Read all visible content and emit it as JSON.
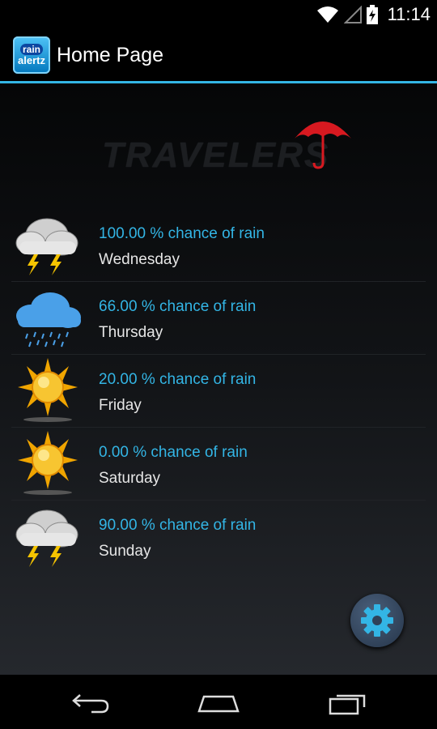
{
  "status_bar": {
    "time": "11:14",
    "icons": [
      "wifi-icon",
      "no-signal-icon",
      "battery-charging-icon"
    ]
  },
  "action_bar": {
    "logo_line1": "rain",
    "logo_line2": "alertz",
    "title": "Home Page"
  },
  "sponsor": {
    "text": "TRAVELERS",
    "colors": {
      "umbrella": "#d71920"
    }
  },
  "forecast": [
    {
      "icon": "thunderstorm-icon",
      "chance": "100.00 % chance of rain",
      "day": "Wednesday"
    },
    {
      "icon": "rain-cloud-icon",
      "chance": "66.00 % chance of rain",
      "day": "Thursday"
    },
    {
      "icon": "sun-icon",
      "chance": "20.00 % chance of rain",
      "day": "Friday"
    },
    {
      "icon": "sun-icon",
      "chance": "0.00 % chance of rain",
      "day": "Saturday"
    },
    {
      "icon": "thunderstorm-icon",
      "chance": "90.00 % chance of rain",
      "day": "Sunday"
    }
  ],
  "colors": {
    "accent": "#33b5e5",
    "day_text": "#e6e6e6"
  },
  "nav_bar": {
    "icons": [
      "back-icon",
      "home-icon",
      "recents-icon"
    ]
  }
}
